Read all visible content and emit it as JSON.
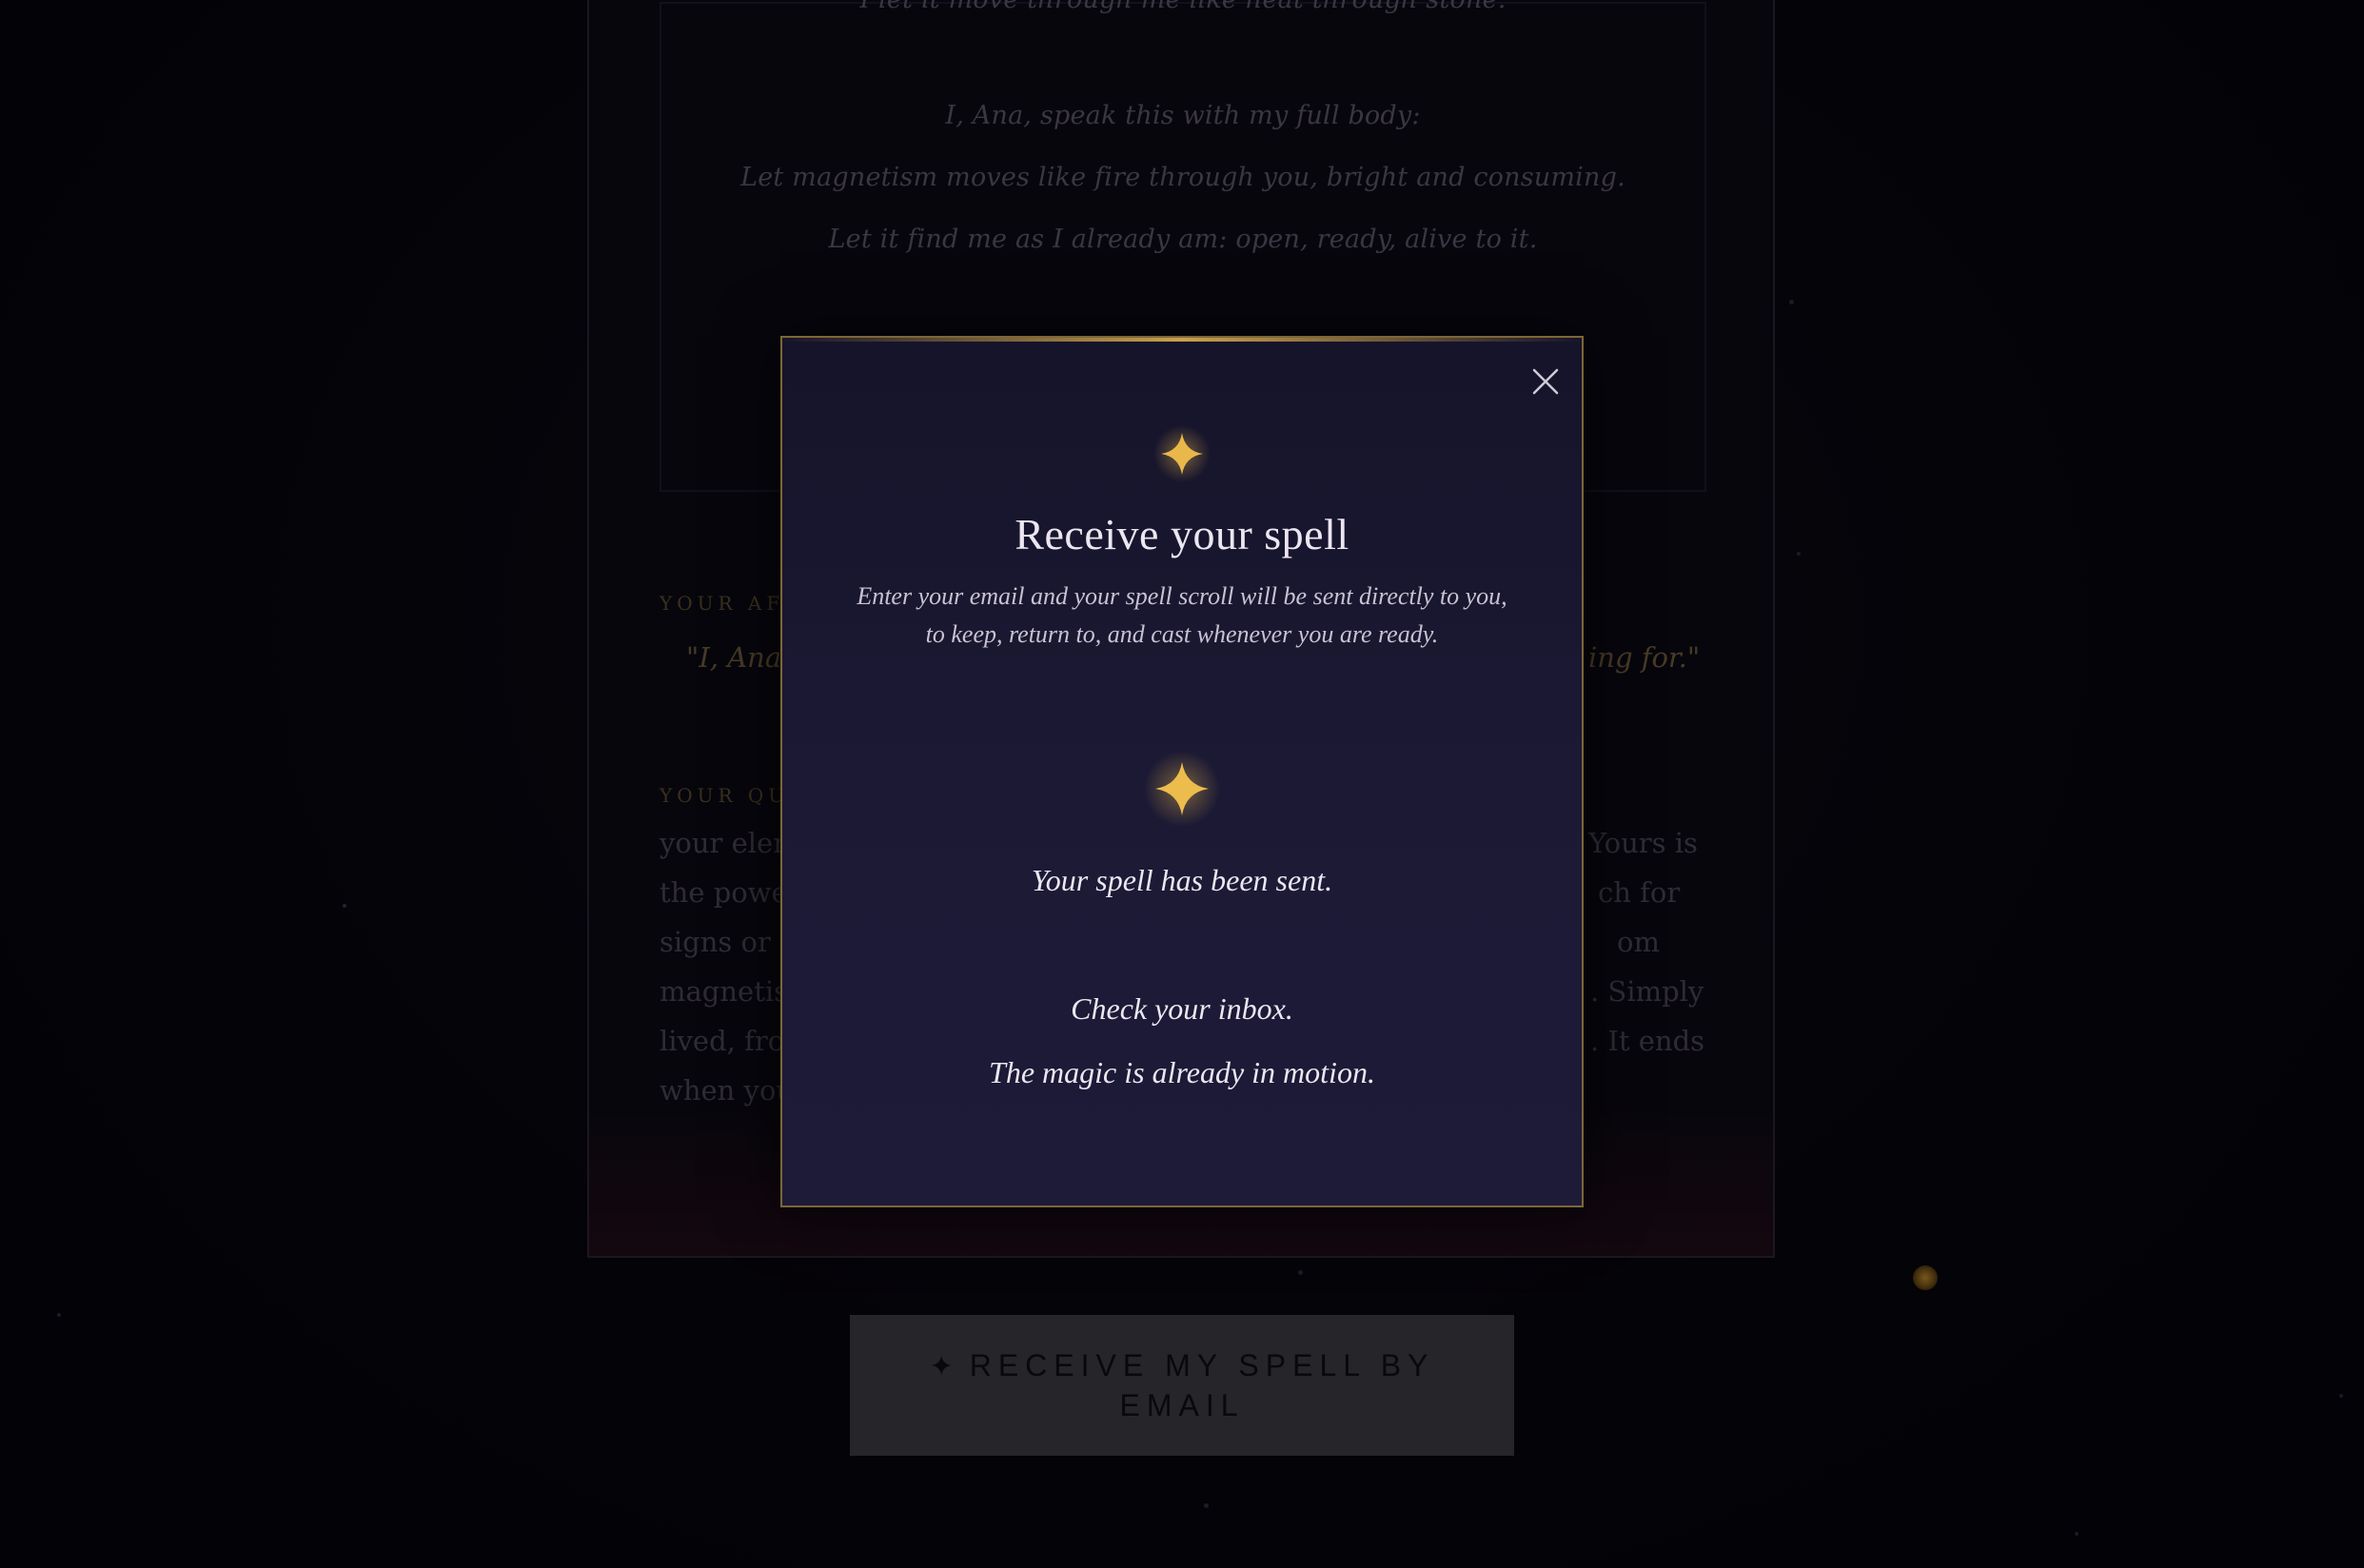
{
  "background": {
    "scroll_lines": [
      "I let it move through me like heat through stone.",
      "I, Ana, speak this with my full body:",
      "Let magnetism moves like fire through you, bright and consuming.",
      "Let it find me as I already am: open, ready, alive to it."
    ],
    "affirmation_label": "YOUR AFF",
    "affirmation_left": "\"I, Ana,",
    "affirmation_right": "ing for.\"",
    "quality_label": "YOUR QUA",
    "paragraph_left": [
      "your elem",
      "the power",
      "signs or a",
      "magnetism",
      "lived, from",
      "when you"
    ],
    "paragraph_right": [
      "Yours is",
      "ch for",
      "om",
      ". Simply",
      ". It ends"
    ]
  },
  "email_button": {
    "icon": "four-point-star-icon",
    "label": "RECEIVE MY SPELL BY EMAIL"
  },
  "modal": {
    "close_icon": "close-icon",
    "top_icon": "sparkle-icon",
    "title": "Receive your spell",
    "subtitle": "Enter your email and your spell scroll will be sent directly to you, to keep, return to, and cast whenever you are ready.",
    "success_icon": "sparkle-icon",
    "sent_message": "Your spell has been sent.",
    "inbox_message": "Check your inbox.",
    "motion_message": "The magic is already in motion."
  },
  "colors": {
    "gold": "#e9b84a",
    "modal_border": "#7d6636",
    "modal_bg": "#1b1934",
    "button_bg": "#3b3a40"
  }
}
